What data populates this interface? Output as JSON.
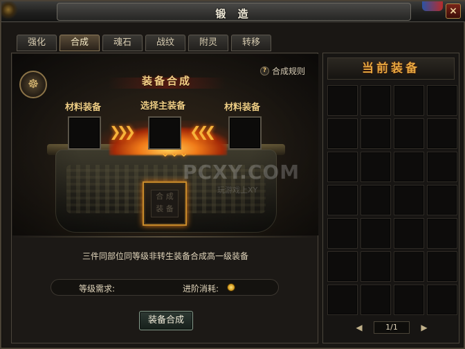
{
  "window": {
    "title": "锻 造",
    "close_label": "×"
  },
  "tabs": [
    {
      "label": "强化",
      "active": false
    },
    {
      "label": "合成",
      "active": true
    },
    {
      "label": "魂石",
      "active": false
    },
    {
      "label": "战纹",
      "active": false
    },
    {
      "label": "附灵",
      "active": false
    },
    {
      "label": "转移",
      "active": false
    }
  ],
  "synthesis": {
    "emblem_glyph": "☸",
    "section_title": "装备合成",
    "rules_link": "合成规则",
    "help_glyph": "?",
    "left_slot_label": "材料装备",
    "main_slot_label": "选择主装备",
    "right_slot_label": "材料装备",
    "arrows_right": "❯❯❯",
    "arrows_left": "❮❮❮",
    "down_arrows": "⌄⌄⌄",
    "result_glyphs": "合 成 装 备",
    "description": "三件同部位同等级非转生装备合成高一级装备",
    "level_req_label": "等级需求:",
    "cost_label": "进阶消耗:",
    "button_label": "装备合成"
  },
  "watermark": {
    "text": "PCXY.COM",
    "sub": "玩游戏上XY"
  },
  "equipment": {
    "title": "当前装备",
    "grid": {
      "columns": 4,
      "rows": 7
    },
    "page": "1/1",
    "prev_glyph": "◀",
    "next_glyph": "▶"
  },
  "colors": {
    "gold_text": "#f0cf86",
    "fire": "#f07a18",
    "panel_bg": "#1c1916"
  }
}
